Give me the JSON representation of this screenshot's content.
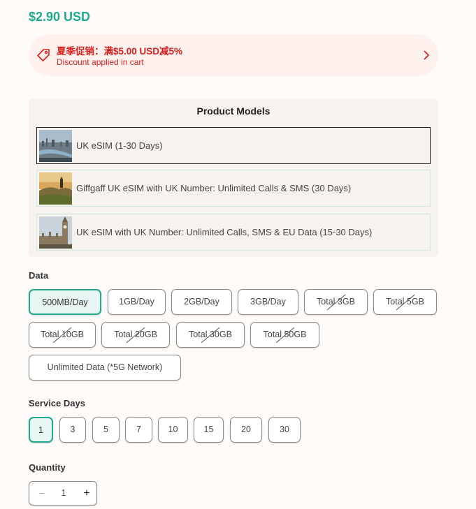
{
  "price": "$2.90 USD",
  "promo": {
    "title": "夏季促销：满$5.00 USD减5%",
    "subtitle": "Discount applied in cart",
    "icon": "tag-icon",
    "chevron_icon": "chevron-right-icon",
    "color": "#d81e1e"
  },
  "models": {
    "heading": "Product Models",
    "items": [
      {
        "label": "UK eSIM (1-30 Days)",
        "selected": true,
        "thumb": "london-cityscape-image"
      },
      {
        "label": "Giffgaff UK eSIM with UK Number: Unlimited Calls & SMS (30 Days)",
        "selected": false,
        "thumb": "scottish-highlands-image"
      },
      {
        "label": "UK eSIM with UK Number: Unlimited Calls, SMS & EU Data (15-30 Days)",
        "selected": false,
        "thumb": "big-ben-image"
      }
    ]
  },
  "data_section": {
    "label": "Data",
    "options": [
      {
        "label": "500MB/Day",
        "active": true,
        "available": true
      },
      {
        "label": "1GB/Day",
        "active": false,
        "available": true
      },
      {
        "label": "2GB/Day",
        "active": false,
        "available": true
      },
      {
        "label": "3GB/Day",
        "active": false,
        "available": true
      },
      {
        "label": "Total 3GB",
        "active": false,
        "available": false
      },
      {
        "label": "Total 5GB",
        "active": false,
        "available": false
      },
      {
        "label": "Total 10GB",
        "active": false,
        "available": false
      },
      {
        "label": "Total 20GB",
        "active": false,
        "available": false
      },
      {
        "label": "Total 30GB",
        "active": false,
        "available": false
      },
      {
        "label": "Total 50GB",
        "active": false,
        "available": false
      },
      {
        "label": "Unlimited Data (*5G Network)",
        "active": false,
        "available": true
      }
    ]
  },
  "days_section": {
    "label": "Service Days",
    "options": [
      {
        "label": "1",
        "active": true
      },
      {
        "label": "3",
        "active": false
      },
      {
        "label": "5",
        "active": false
      },
      {
        "label": "7",
        "active": false
      },
      {
        "label": "10",
        "active": false
      },
      {
        "label": "15",
        "active": false
      },
      {
        "label": "20",
        "active": false
      },
      {
        "label": "30",
        "active": false
      }
    ]
  },
  "quantity": {
    "label": "Quantity",
    "value": "1",
    "minus": "−",
    "plus": "+"
  },
  "colors": {
    "accent": "#1fa98e",
    "promo_text": "#d81e1e",
    "promo_bg": "#fff2ee"
  }
}
